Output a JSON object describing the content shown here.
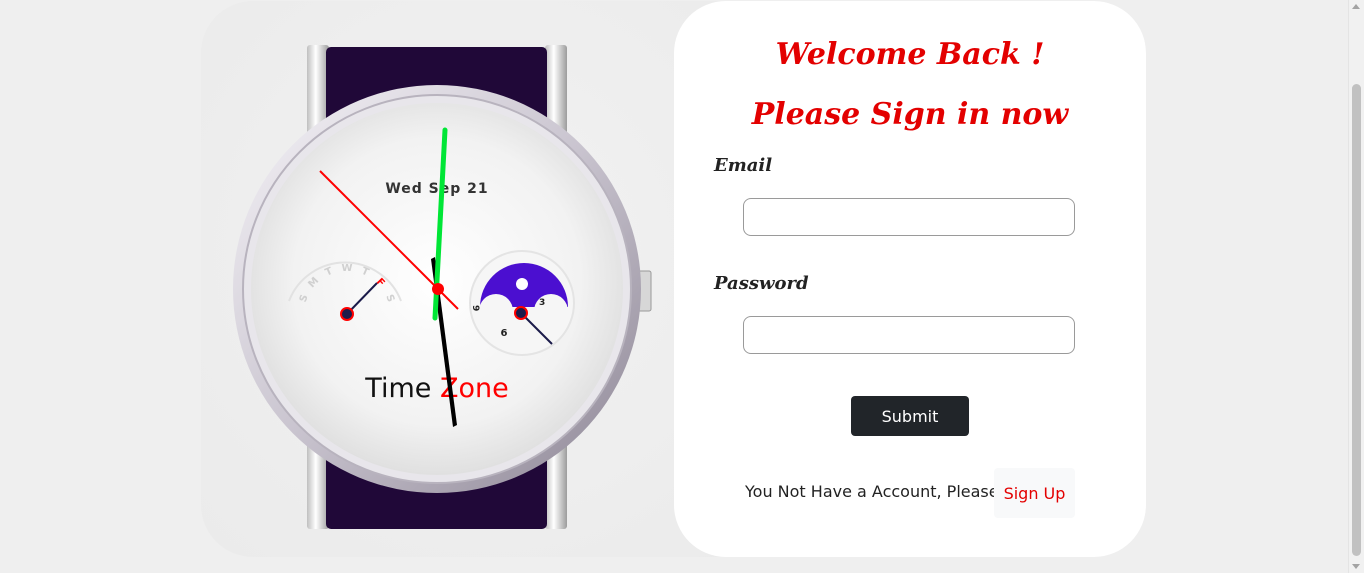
{
  "watch": {
    "date_display": "Wed Sep 21",
    "brand_part1": "Time ",
    "brand_part2": "Zone",
    "weekday_initials": [
      "S",
      "M",
      "T",
      "W",
      "T",
      "F",
      "S"
    ],
    "active_weekday": "F",
    "subdial_right_numbers": [
      "9",
      "3",
      "6"
    ],
    "strap_color": "#200838",
    "second_hand_color": "#00e636",
    "accent_color": "#ff0000",
    "moon_dial_color": "#4b0fd0"
  },
  "form": {
    "welcome": "Welcome Back !",
    "prompt": "Please Sign in now",
    "email_label": "Email",
    "email_value": "",
    "password_label": "Password",
    "password_value": "",
    "submit_label": "Submit",
    "no_account_text": "You Not Have a Account, Please !",
    "signup_label": "Sign Up",
    "accent_color": "#e30000"
  }
}
